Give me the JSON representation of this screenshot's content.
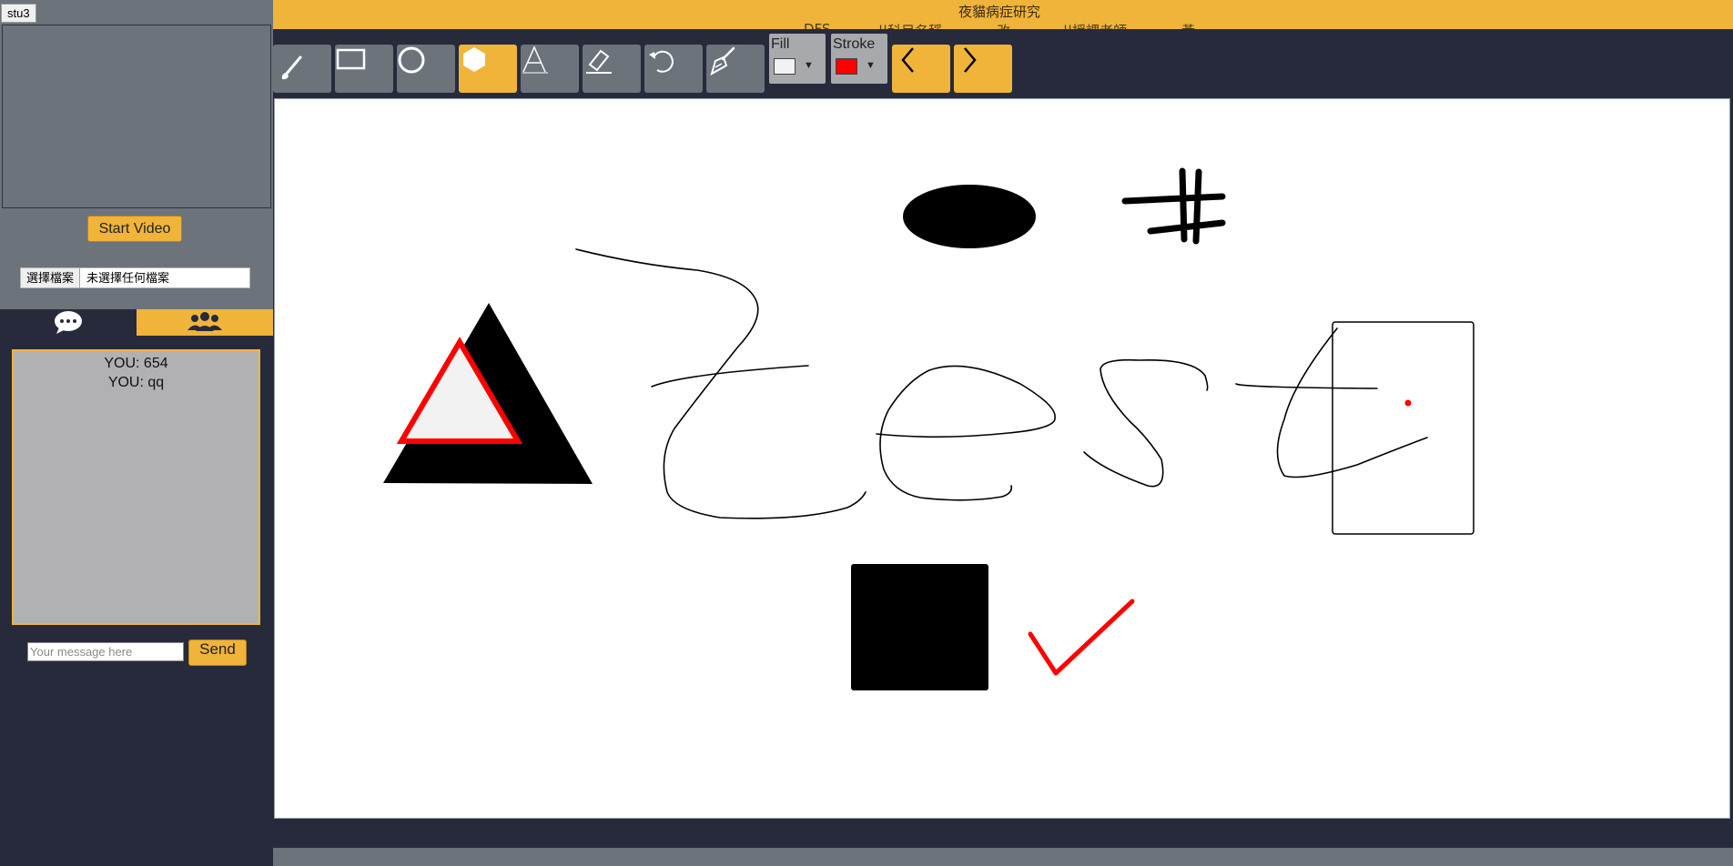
{
  "user": {
    "name": "stu3"
  },
  "video": {
    "start_label": "Start Video"
  },
  "file_upload": {
    "button_label": "選擇檔案",
    "status": "未選擇任何檔案"
  },
  "tabs": [
    {
      "name": "chat",
      "icon": "chat-bubble-icon",
      "active": false
    },
    {
      "name": "users",
      "icon": "users-icon",
      "active": true
    }
  ],
  "chat": {
    "messages": [
      "YOU: 654",
      "YOU: qq"
    ],
    "input_placeholder": "Your message here",
    "send_label": "Send"
  },
  "header": {
    "title": "夜貓病症研究",
    "subtitle_segments": [
      "DFS",
      "||科目名稱",
      "改",
      "||授課老師",
      "黃"
    ]
  },
  "toolbar": {
    "tools": [
      {
        "name": "brush",
        "icon": "brush-icon",
        "active": false
      },
      {
        "name": "rectangle",
        "icon": "rectangle-icon",
        "active": false
      },
      {
        "name": "circle",
        "icon": "circle-icon",
        "active": false
      },
      {
        "name": "polygon",
        "icon": "hexagon-icon",
        "active": true
      },
      {
        "name": "text",
        "icon": "text-icon",
        "active": false
      },
      {
        "name": "eraser",
        "icon": "eraser-icon",
        "active": false
      },
      {
        "name": "undo",
        "icon": "undo-icon",
        "active": false
      },
      {
        "name": "clear",
        "icon": "broom-icon",
        "active": false
      }
    ],
    "fill": {
      "label": "Fill",
      "color": "#f2f2f2"
    },
    "stroke": {
      "label": "Stroke",
      "color": "#ff0000"
    },
    "nav": [
      {
        "name": "previous-page",
        "icon": "chevron-left-icon"
      },
      {
        "name": "next-page",
        "icon": "chevron-right-icon"
      }
    ]
  },
  "colors": {
    "accent": "#f0b43a",
    "panel": "#262a3b",
    "gray": "#6c737b"
  }
}
